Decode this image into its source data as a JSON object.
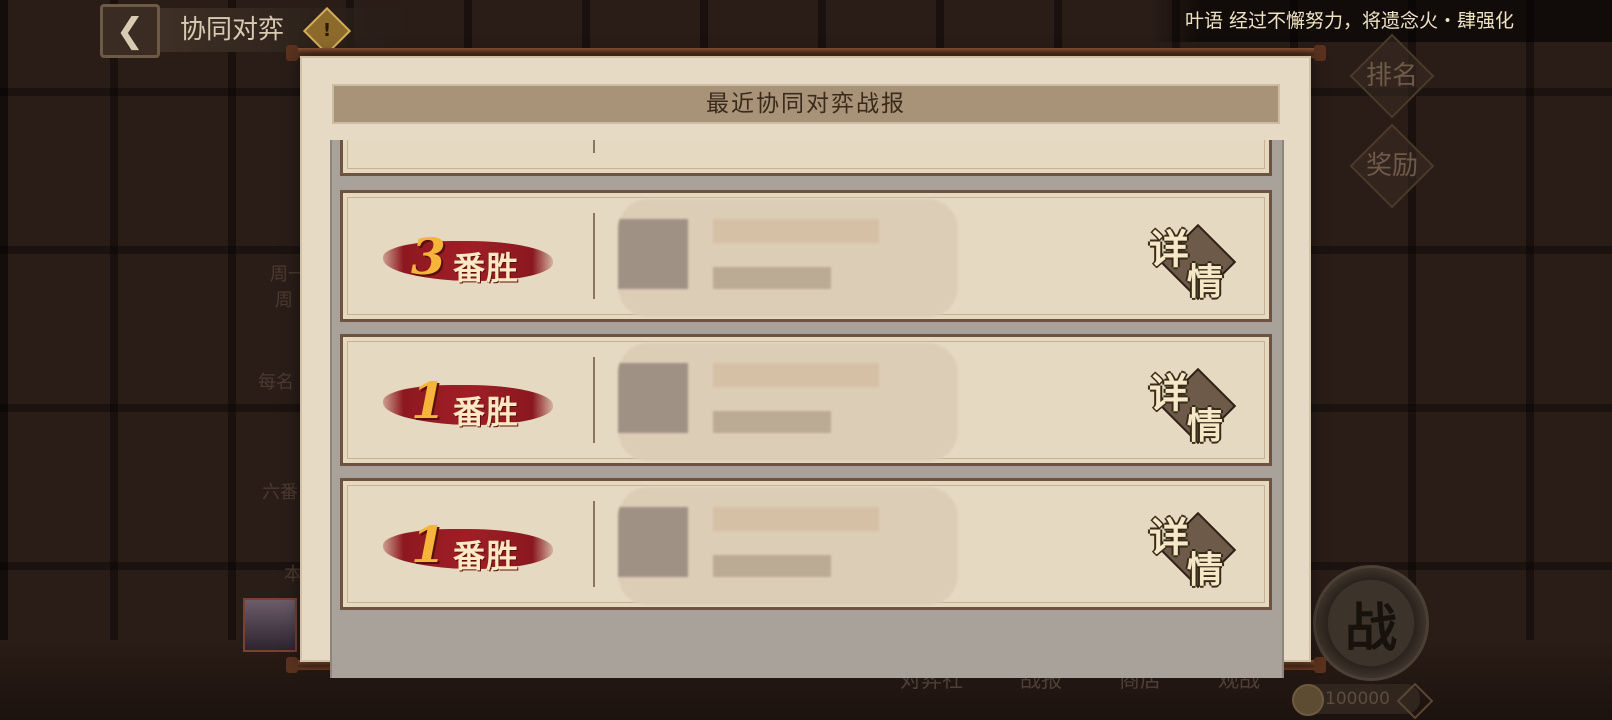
{
  "header": {
    "back_icon": "chevron-left-icon",
    "title": "协同对弈",
    "warning_icon": "exclamation-icon",
    "warning_glyph": "!"
  },
  "ticker": {
    "text": "叶语 经过不懈努力，将遗念火・肆强化"
  },
  "right_menu": {
    "ranking": "排名",
    "rewards": "奖励",
    "fight": "战"
  },
  "bottom_tabs": [
    "对弈社",
    "战报",
    "商店",
    "观战"
  ],
  "currency": {
    "amount": "100000",
    "coin_icon": "coin-icon",
    "plus_icon": "plus-icon"
  },
  "left_panel": {
    "line1": "周一",
    "line2": "周",
    "line3": "每名",
    "line4": "六番",
    "line5": "本"
  },
  "modal": {
    "title": "最近协同对弈战报",
    "entries": [
      {
        "wins": "3",
        "win_label": "番胜",
        "detail_line1": "详",
        "detail_line2": "情"
      },
      {
        "wins": "1",
        "win_label": "番胜",
        "detail_line1": "详",
        "detail_line2": "情"
      },
      {
        "wins": "1",
        "win_label": "番胜",
        "detail_line1": "详",
        "detail_line2": "情"
      }
    ]
  },
  "colors": {
    "modal_bg": "#e7dac4",
    "header_bar": "#a89379",
    "win_red": "#9a1c24",
    "win_gold": "#f6b43a"
  }
}
